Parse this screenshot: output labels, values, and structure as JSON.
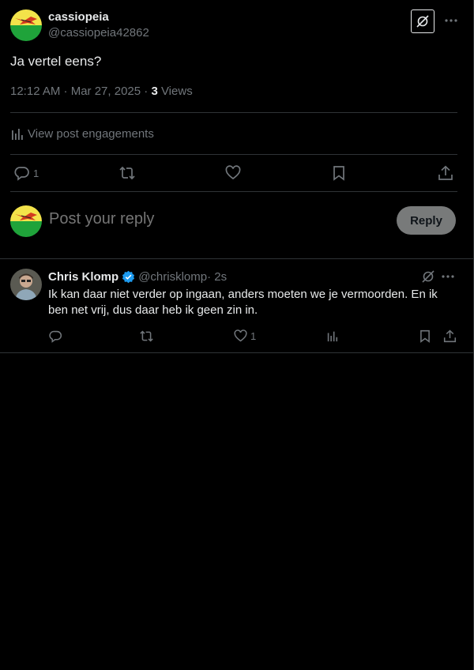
{
  "post": {
    "author_name": "cassiopeia",
    "author_handle": "@cassiopeia42862",
    "text": "Ja vertel eens?",
    "timestamp": "12:12 AM · Mar 27, 2025 · ",
    "views_count": "3",
    "views_label": " Views",
    "engagements_label": "View post engagements",
    "reply_count": "1",
    "icons": [
      "grok-icon",
      "more-icon",
      "analytics-icon",
      "reply-icon",
      "retweet-icon",
      "like-icon",
      "bookmark-icon",
      "share-icon"
    ]
  },
  "composer": {
    "placeholder": "Post your reply",
    "reply_button": "Reply"
  },
  "reply": {
    "author_name": "Chris Klomp",
    "author_handle": "@chrisklomp",
    "time": " · 2s",
    "text": "Ik kan daar niet verder op ingaan, anders moeten we je vermoorden. En ik ben net vrij, dus daar heb ik geen zin in.",
    "like_count": "1"
  },
  "colors": {
    "background": "#000000",
    "text": "#e7e9ea",
    "muted": "#71767b",
    "border": "#2f3336",
    "verified": "#1d9bf0",
    "reply_button_bg": "#787a7a"
  }
}
